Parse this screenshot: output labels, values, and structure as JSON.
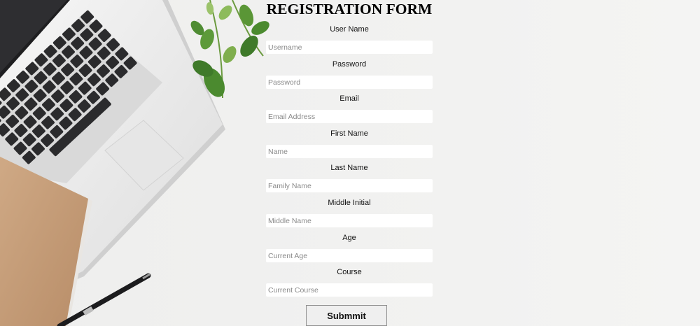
{
  "form": {
    "title": "REGISTRATION FORM",
    "fields": [
      {
        "label": "User Name",
        "placeholder": "Username",
        "value": ""
      },
      {
        "label": "Password",
        "placeholder": "Password",
        "value": ""
      },
      {
        "label": "Email",
        "placeholder": "Email Address",
        "value": ""
      },
      {
        "label": "First Name",
        "placeholder": "Name",
        "value": ""
      },
      {
        "label": "Last Name",
        "placeholder": "Family Name",
        "value": ""
      },
      {
        "label": "Middle Initial",
        "placeholder": "Middle Name",
        "value": ""
      },
      {
        "label": "Age",
        "placeholder": "Current Age",
        "value": ""
      },
      {
        "label": "Course",
        "placeholder": "Current Course",
        "value": ""
      }
    ],
    "submit_label": "Submmit"
  },
  "background": {
    "description_icons": [
      "laptop-image",
      "plant-leaves-image",
      "notebook-image",
      "pen-image"
    ],
    "colors": {
      "backdrop": "#f1f1f0",
      "laptop_silver": "#e9e9e9",
      "keys": "#2b2b2d",
      "notebook": "#c9a27f",
      "leaf": "#3f7a2a"
    }
  }
}
